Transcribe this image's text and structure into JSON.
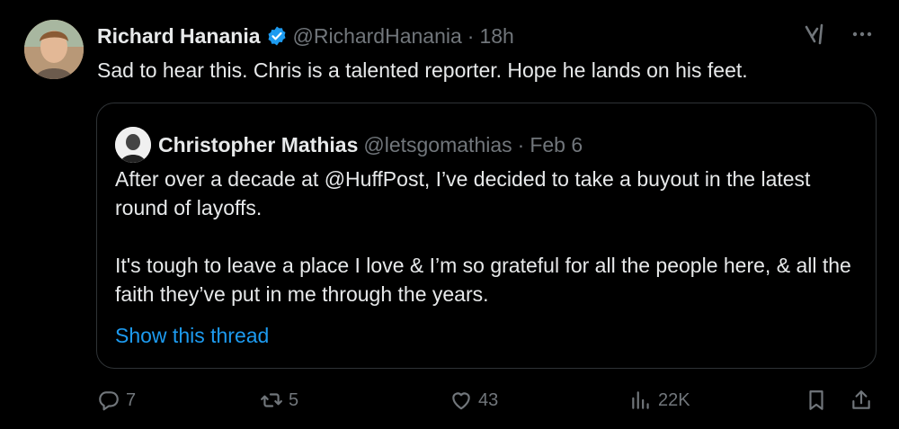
{
  "tweet": {
    "author_name": "Richard Hanania",
    "handle": "@RichardHanania",
    "separator": "·",
    "time": "18h",
    "text": "Sad to hear this. Chris is a talented reporter. Hope he lands on his feet.",
    "verified_icon": "verified-badge-icon",
    "grok_icon": "grok-icon",
    "more_icon": "more-icon"
  },
  "quote": {
    "author_name": "Christopher Mathias",
    "handle": "@letsgomathias",
    "separator": "·",
    "time": "Feb 6",
    "paragraph1": "After over a decade at @HuffPost, I’ve decided to take a buyout in the latest round of layoffs.",
    "paragraph2": "It's tough to leave a place I love & I’m so grateful for all the people here, & all the faith they’ve put in me through the years.",
    "show_thread": "Show this thread"
  },
  "actions": {
    "replies": "7",
    "reposts": "5",
    "likes": "43",
    "views": "22K"
  },
  "colors": {
    "background": "#000000",
    "text": "#e7e9ea",
    "muted": "#71767b",
    "accent": "#1d9bf0",
    "border": "#2f3336"
  }
}
